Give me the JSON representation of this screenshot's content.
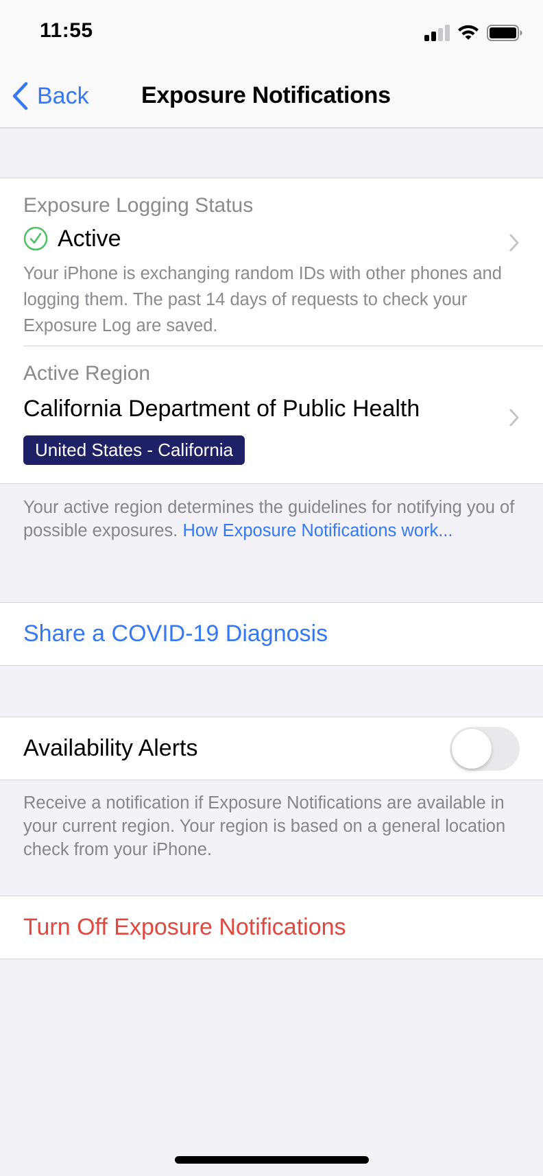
{
  "status_bar": {
    "time": "11:55",
    "signal_bars_active": 2,
    "signal_bars_total": 4,
    "icons": [
      "cellular-signal-icon",
      "wifi-icon",
      "battery-icon"
    ]
  },
  "nav": {
    "back_label": "Back",
    "title": "Exposure Notifications"
  },
  "logging": {
    "header": "Exposure Logging Status",
    "status": "Active",
    "status_icon": "checkmark-circle-icon",
    "description": "Your iPhone is exchanging random IDs with other phones and logging them. The past 14 days of requests to check your Exposure Log are saved."
  },
  "region": {
    "header": "Active Region",
    "authority": "California Department of Public Health",
    "badge": "United States - California",
    "footer_text": "Your active region determines the guidelines for notifying you of possible exposures. ",
    "footer_link": "How Exposure Notifications work..."
  },
  "share": {
    "label": "Share a COVID-19 Diagnosis"
  },
  "alerts": {
    "label": "Availability Alerts",
    "enabled": false,
    "footer_text": "Receive a notification if Exposure Notifications are available in your current region. Your region is based on a general location check from your iPhone."
  },
  "turn_off": {
    "label": "Turn Off Exposure Notifications"
  },
  "colors": {
    "accent_blue": "#3478f6",
    "destructive_red": "#e0483e",
    "active_green": "#4cc160",
    "badge_navy": "#1f2166",
    "grouped_background": "#f2f2f7"
  }
}
